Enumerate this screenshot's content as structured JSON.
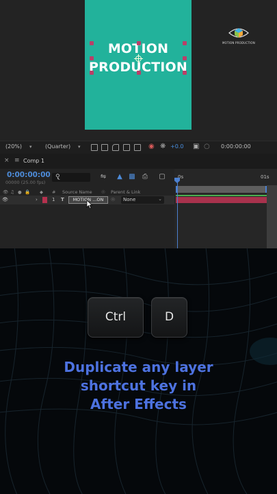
{
  "composition": {
    "text_line1": "MOTION",
    "text_line2": "PRODUCTION",
    "background_color": "#22b29b",
    "handle_color": "#b84069",
    "logo_text": "MOTION PRODUCTION"
  },
  "viewer_toolbar": {
    "magnification": "(20%)",
    "resolution": "(Quarter)",
    "exposure": "+0.0",
    "timecode": "0:00:00:00"
  },
  "timeline": {
    "tab_name": "Comp 1",
    "current_time": "0:00:00:00",
    "frame_info": "00000 (25.00 fps)",
    "columns": {
      "number": "#",
      "source_name": "Source Name",
      "parent_link": "Parent & Link"
    },
    "layer": {
      "index": "1",
      "type_icon": "T",
      "name": "MOTION ...ON",
      "parent": "None",
      "label_color": "#b5314e"
    },
    "ruler": {
      "start": "0s",
      "end": "01s"
    },
    "accent_color": "#4c80d0"
  },
  "overlay": {
    "keys": [
      "Ctrl",
      "D"
    ],
    "caption_line1": "Duplicate any layer",
    "caption_line2": "shortcut key in",
    "caption_line3": "After Effects",
    "caption_color": "#4d72e0"
  }
}
